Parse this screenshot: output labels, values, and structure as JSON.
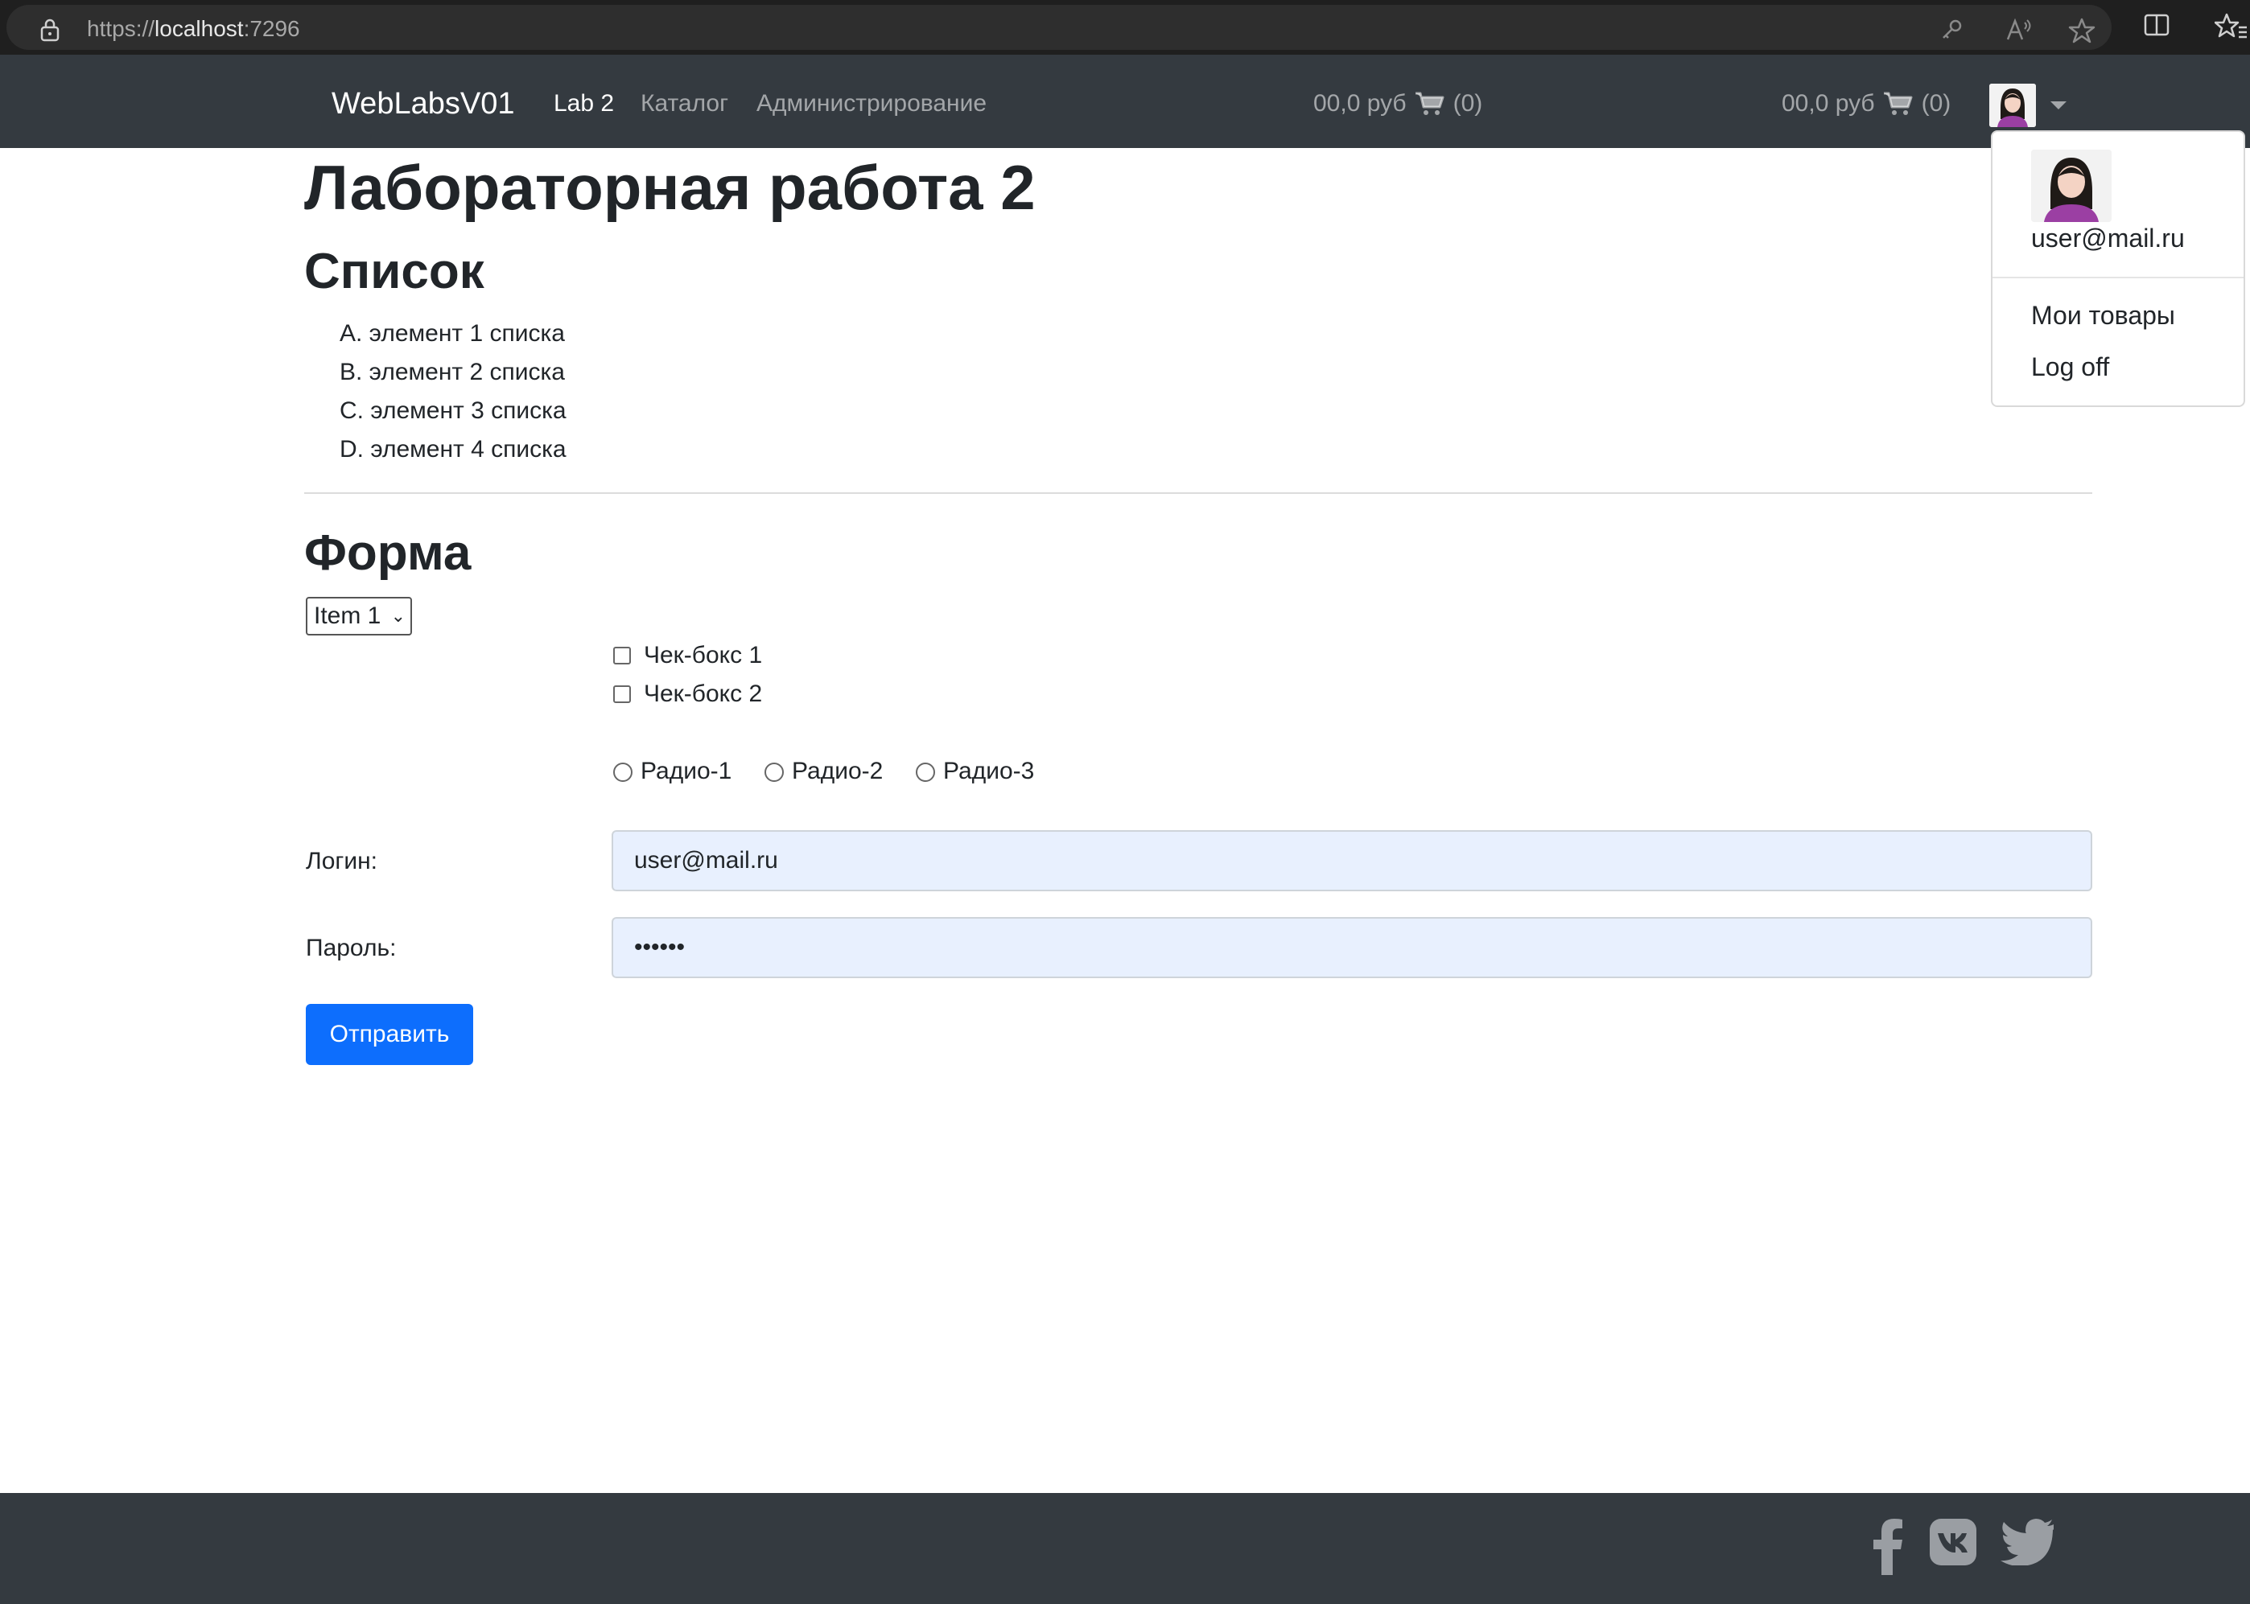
{
  "browser": {
    "url_scheme": "https://",
    "url_host": "localhost",
    "url_port": ":7296"
  },
  "navbar": {
    "brand": "WebLabsV01",
    "links": [
      {
        "label": "Lab 2",
        "active": true
      },
      {
        "label": "Каталог",
        "active": false
      },
      {
        "label": "Администрирование",
        "active": false
      }
    ],
    "cart_1": {
      "amount": "00,0 руб",
      "count": "(0)"
    },
    "cart_2": {
      "amount": "00,0 руб",
      "count": "(0)"
    }
  },
  "user_menu": {
    "email": "user@mail.ru",
    "items": [
      "Мои товары",
      "Log off"
    ]
  },
  "main": {
    "title": "Лабораторная работа 2",
    "list_heading": "Список",
    "list_items": [
      "A. элемент 1 списка",
      "B. элемент 2 списка",
      "C. элемент 3 списка",
      "D. элемент 4 списка"
    ],
    "form_heading": "Форма",
    "select_value": "Item 1",
    "checkboxes": [
      "Чек-бокс 1",
      "Чек-бокс 2"
    ],
    "radios": [
      "Радио-1",
      "Радио-2",
      "Радио-3"
    ],
    "login_label": "Логин:",
    "login_value": "user@mail.ru",
    "password_label": "Пароль:",
    "password_value": "••••••",
    "submit_label": "Отправить"
  },
  "footer": {
    "social_icons": [
      "facebook-icon",
      "vk-icon",
      "twitter-icon"
    ]
  },
  "colors": {
    "navbar_bg": "#343a40",
    "primary": "#0d6efd",
    "input_bg": "#e8f0fe"
  }
}
